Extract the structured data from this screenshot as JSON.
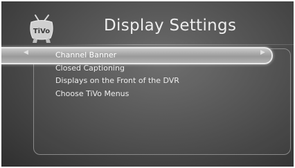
{
  "header": {
    "title": "Display Settings",
    "logo_text": "TiVo"
  },
  "menu": {
    "items": [
      {
        "label": "Channel Banner",
        "selected": true
      },
      {
        "label": "Closed Captioning",
        "selected": false
      },
      {
        "label": "Displays on the Front of the DVR",
        "selected": false
      },
      {
        "label": "Choose TiVo Menus",
        "selected": false
      }
    ]
  },
  "icons": {
    "logo": "tivo-logo-icon",
    "left_arrow": "left-arrow-icon",
    "right_arrow": "right-arrow-icon"
  }
}
